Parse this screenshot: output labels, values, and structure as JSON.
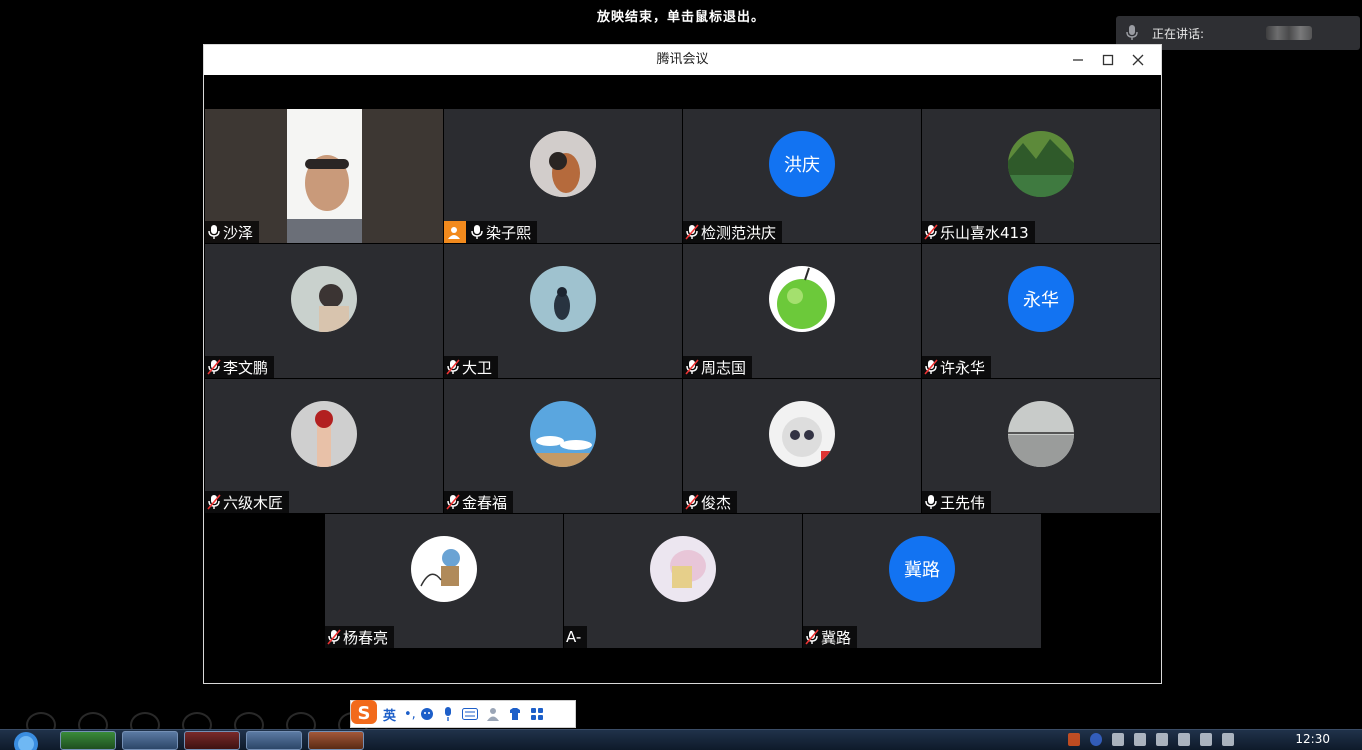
{
  "banner": "放映结束，单击鼠标退出。",
  "speaking": {
    "label": "正在讲话:"
  },
  "window": {
    "title": "腾讯会议"
  },
  "participants": [
    {
      "name": "沙泽",
      "type": "video",
      "mic": "on"
    },
    {
      "name": "染子熙",
      "type": "image",
      "mic": "on",
      "host": true,
      "avatar_desc": "photo"
    },
    {
      "name": "检测范洪庆",
      "type": "text",
      "avatar_text": "洪庆",
      "mic": "muted"
    },
    {
      "name": "乐山喜水413",
      "type": "image",
      "mic": "muted"
    },
    {
      "name": "李文鹏",
      "type": "image",
      "mic": "muted"
    },
    {
      "name": "大卫",
      "type": "image",
      "mic": "muted"
    },
    {
      "name": "周志国",
      "type": "image",
      "mic": "muted"
    },
    {
      "name": "许永华",
      "type": "text",
      "avatar_text": "永华",
      "mic": "muted"
    },
    {
      "name": "六级木匠",
      "type": "image",
      "mic": "muted"
    },
    {
      "name": "金春福",
      "type": "image",
      "mic": "muted"
    },
    {
      "name": "俊杰",
      "type": "image",
      "mic": "muted"
    },
    {
      "name": "王先伟",
      "type": "image",
      "mic": "on"
    },
    {
      "name": "杨春亮",
      "type": "image",
      "mic": "muted"
    },
    {
      "name": "A-",
      "type": "image",
      "mic": "none"
    },
    {
      "name": "冀路",
      "type": "text",
      "avatar_text": "冀路",
      "mic": "muted"
    }
  ],
  "ime": {
    "mode": "英",
    "punct": "•,",
    "logo": "S"
  },
  "taskbar": {
    "time": "12:30"
  },
  "colors": {
    "tile_bg": "#2b2c30",
    "avatar_blue": "#1273f2",
    "host_badge": "#f28a1d"
  }
}
